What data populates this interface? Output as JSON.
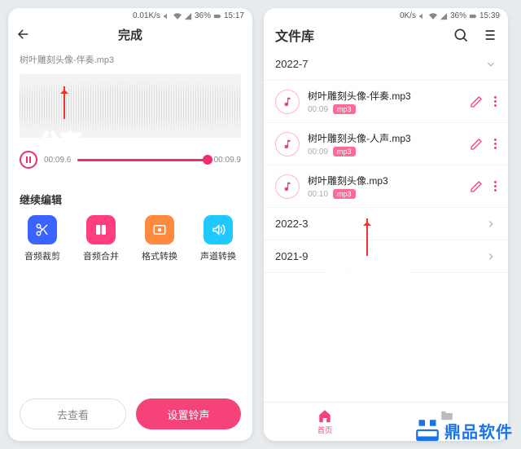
{
  "left": {
    "status": {
      "net": "0.01K/s",
      "batt": "36%",
      "time": "15:17"
    },
    "title": "完成",
    "filename": "树叶雕刻头像-伴奏.mp3",
    "play": {
      "current": "00:09.6",
      "total": "00:09.9"
    },
    "section": "继续编辑",
    "tools": [
      {
        "label": "音频裁剪",
        "cls": "c-blue",
        "icon": "scissors"
      },
      {
        "label": "音频合并",
        "cls": "c-pink",
        "icon": "merge"
      },
      {
        "label": "格式转换",
        "cls": "c-orange",
        "icon": "convert"
      },
      {
        "label": "声道转换",
        "cls": "c-cyan",
        "icon": "channel"
      }
    ],
    "btn_ghost": "去查看",
    "btn_primary": "设置铃声",
    "anno": "分离"
  },
  "right": {
    "status": {
      "net": "0K/s",
      "batt": "36%",
      "time": "15:39"
    },
    "title": "文件库",
    "groups": [
      {
        "label": "2022-7",
        "open": true,
        "files": [
          {
            "name": "树叶雕刻头像-伴奏.mp3",
            "dur": "00:09",
            "ext": "mp3"
          },
          {
            "name": "树叶雕刻头像-人声.mp3",
            "dur": "00:09",
            "ext": "mp3"
          },
          {
            "name": "树叶雕刻头像.mp3",
            "dur": "00:10",
            "ext": "mp3"
          }
        ]
      },
      {
        "label": "2022-3",
        "open": false
      },
      {
        "label": "2021-9",
        "open": false
      }
    ],
    "tabs": [
      {
        "label": "首页",
        "active": true
      },
      {
        "label": "文"
      }
    ],
    "anno": "提取文件"
  },
  "brand": "鼎品软件"
}
